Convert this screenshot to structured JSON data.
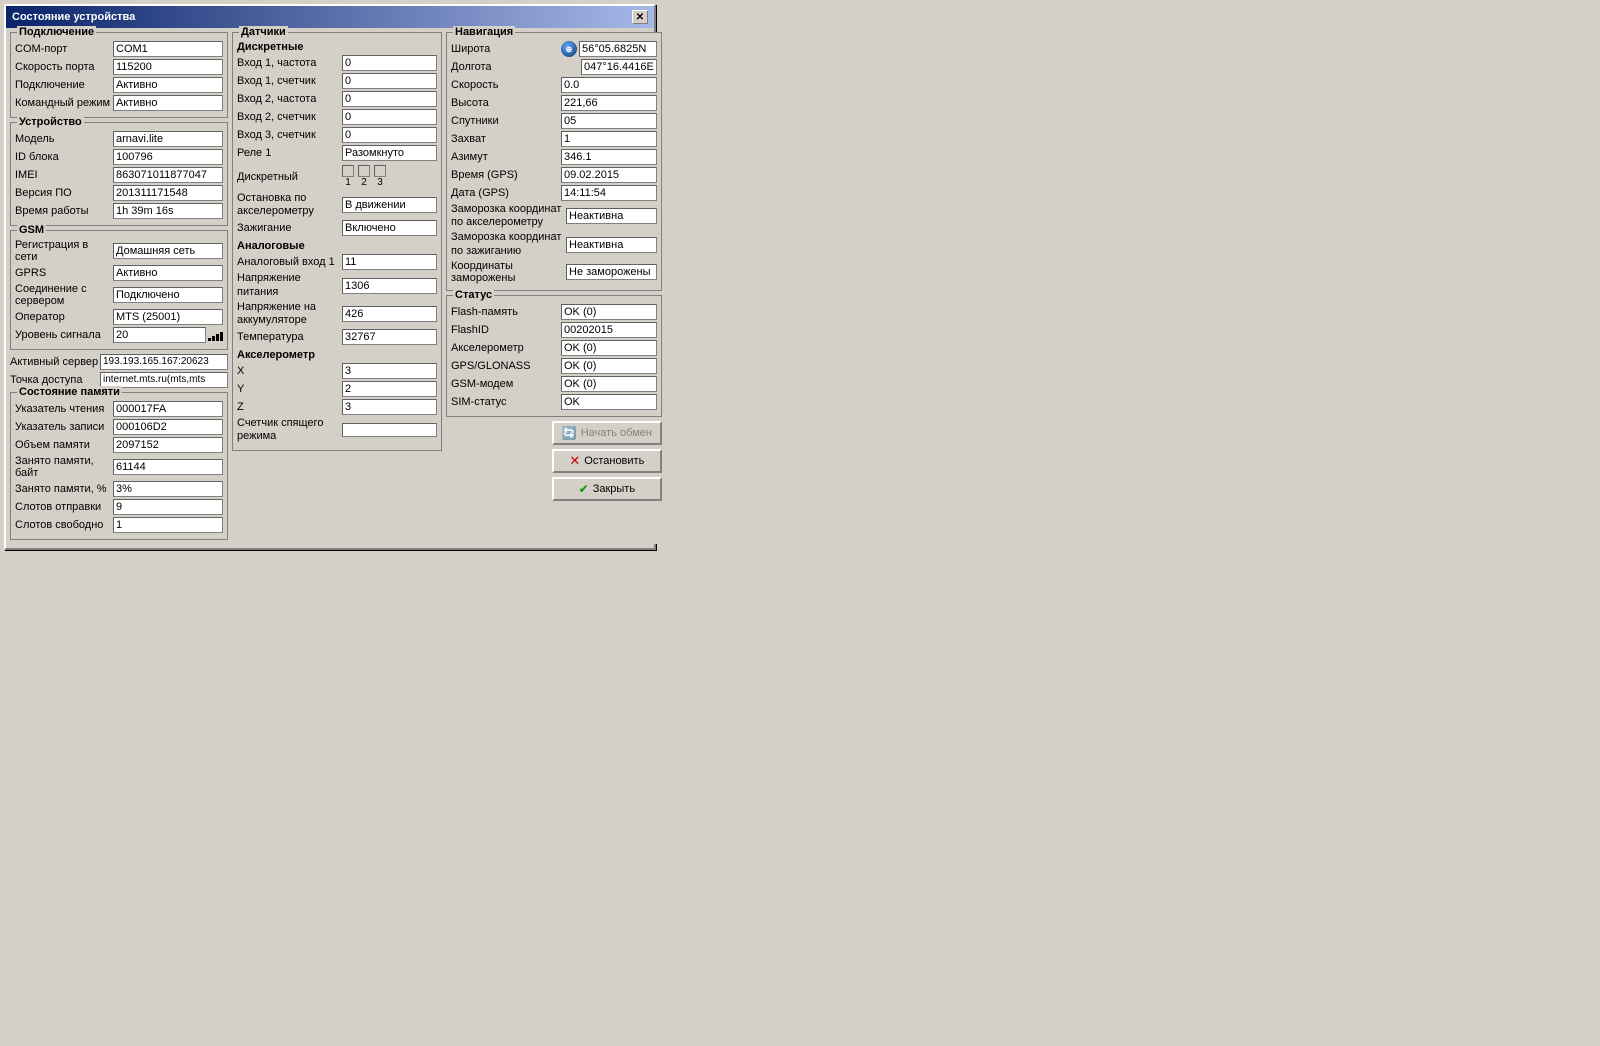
{
  "window": {
    "title": "Состояние устройства",
    "close_label": "✕"
  },
  "connection": {
    "group_title": "Подключение",
    "fields": [
      {
        "label": "COM-порт",
        "value": "COM1"
      },
      {
        "label": "Скорость порта",
        "value": "115200"
      },
      {
        "label": "Подключение",
        "value": "Активно"
      },
      {
        "label": "Командный режим",
        "value": "Активно"
      }
    ]
  },
  "device": {
    "group_title": "Устройство",
    "fields": [
      {
        "label": "Модель",
        "value": "arnavi.lite"
      },
      {
        "label": "ID блока",
        "value": "100796"
      },
      {
        "label": "IMEI",
        "value": "863071011877047"
      },
      {
        "label": "Версия ПО",
        "value": "201311171548"
      },
      {
        "label": "Время работы",
        "value": "1h 39m 16s"
      }
    ]
  },
  "gsm": {
    "group_title": "GSM",
    "fields": [
      {
        "label": "Регистрация в сети",
        "value": "Домашняя сеть"
      },
      {
        "label": "GPRS",
        "value": "Активно"
      },
      {
        "label": "Соединение с сервером",
        "value": "Подключено"
      },
      {
        "label": "Оператор",
        "value": "MTS (25001)"
      },
      {
        "label": "Уровень сигнала",
        "value": "20"
      }
    ]
  },
  "active_server": {
    "label": "Активный сервер",
    "value": "193.193.165.167:20623"
  },
  "access_point": {
    "label": "Точка доступа",
    "value": "internet.mts.ru(mts,mts"
  },
  "memory": {
    "group_title": "Состояние памяти",
    "fields": [
      {
        "label": "Указатель чтения",
        "value": "000017FA"
      },
      {
        "label": "Указатель записи",
        "value": "000106D2"
      },
      {
        "label": "Объем памяти",
        "value": "2097152"
      },
      {
        "label": "Занято памяти, байт",
        "value": "61144"
      },
      {
        "label": "Занято памяти, %",
        "value": "3%"
      },
      {
        "label": "Слотов отправки",
        "value": "9"
      },
      {
        "label": "Слотов свободно",
        "value": "1"
      }
    ]
  },
  "sensors": {
    "group_title": "Датчики",
    "discrete_title": "Дискретные",
    "discrete_fields": [
      {
        "label": "Вход 1, частота",
        "value": "0"
      },
      {
        "label": "Вход 1, счетчик",
        "value": "0"
      },
      {
        "label": "Вход 2, частота",
        "value": "0"
      },
      {
        "label": "Вход 2, счетчик",
        "value": "0"
      },
      {
        "label": "Вход 3, счетчик",
        "value": "0"
      },
      {
        "label": "Реле 1",
        "value": "Разомкнуто"
      }
    ],
    "discrete_label": "Дискретный",
    "checkbox_labels": [
      "1",
      "2",
      "3"
    ],
    "stop_accel_label": "Остановка по акселерометру",
    "stop_accel_value": "В движении",
    "ignition_label": "Зажигание",
    "ignition_value": "Включено",
    "analog_title": "Аналоговые",
    "analog_fields": [
      {
        "label": "Аналоговый вход 1",
        "value": "11"
      },
      {
        "label": "Напряжение питания",
        "value": "1306"
      },
      {
        "label": "Напряжение на аккумуляторе",
        "value": "426"
      },
      {
        "label": "Температура",
        "value": "32767"
      }
    ],
    "accel_title": "Акселерометр",
    "accel_fields": [
      {
        "label": "X",
        "value": "3"
      },
      {
        "label": "Y",
        "value": "2"
      },
      {
        "label": "Z",
        "value": "3"
      },
      {
        "label": "Счетчик спящего режима",
        "value": ""
      }
    ]
  },
  "navigation": {
    "group_title": "Навигация",
    "fields": [
      {
        "label": "Широта",
        "value": "56°05.6825N"
      },
      {
        "label": "Долгота",
        "value": "047°16.4416E"
      },
      {
        "label": "Скорость",
        "value": "0.0"
      },
      {
        "label": "Высота",
        "value": "221,66"
      },
      {
        "label": "Спутники",
        "value": "05"
      },
      {
        "label": "Захват",
        "value": "1"
      },
      {
        "label": "Азимут",
        "value": "346.1"
      },
      {
        "label": "Время (GPS)",
        "value": "09.02.2015"
      },
      {
        "label": "Дата (GPS)",
        "value": "14:11:54"
      }
    ],
    "freeze_accel_label": "Заморозка координат по акселерометру",
    "freeze_accel_value": "Неактивна",
    "freeze_ignition_label": "Заморозка координат по зажиганию",
    "freeze_ignition_value": "Неактивна",
    "coords_frozen_label": "Координаты заморожены",
    "coords_frozen_value": "Не заморожены"
  },
  "status": {
    "group_title": "Статус",
    "fields": [
      {
        "label": "Flash-память",
        "value": "OK (0)"
      },
      {
        "label": "FlashID",
        "value": "00202015"
      },
      {
        "label": "Акселерометр",
        "value": "OK (0)"
      },
      {
        "label": "GPS/GLONASS",
        "value": "OK (0)"
      },
      {
        "label": "GSM-модем",
        "value": "OK (0)"
      },
      {
        "label": "SIM-статус",
        "value": "OK"
      }
    ]
  },
  "buttons": {
    "start_exchange": "Начать обмен",
    "stop": "Остановить",
    "close": "Закрыть"
  }
}
